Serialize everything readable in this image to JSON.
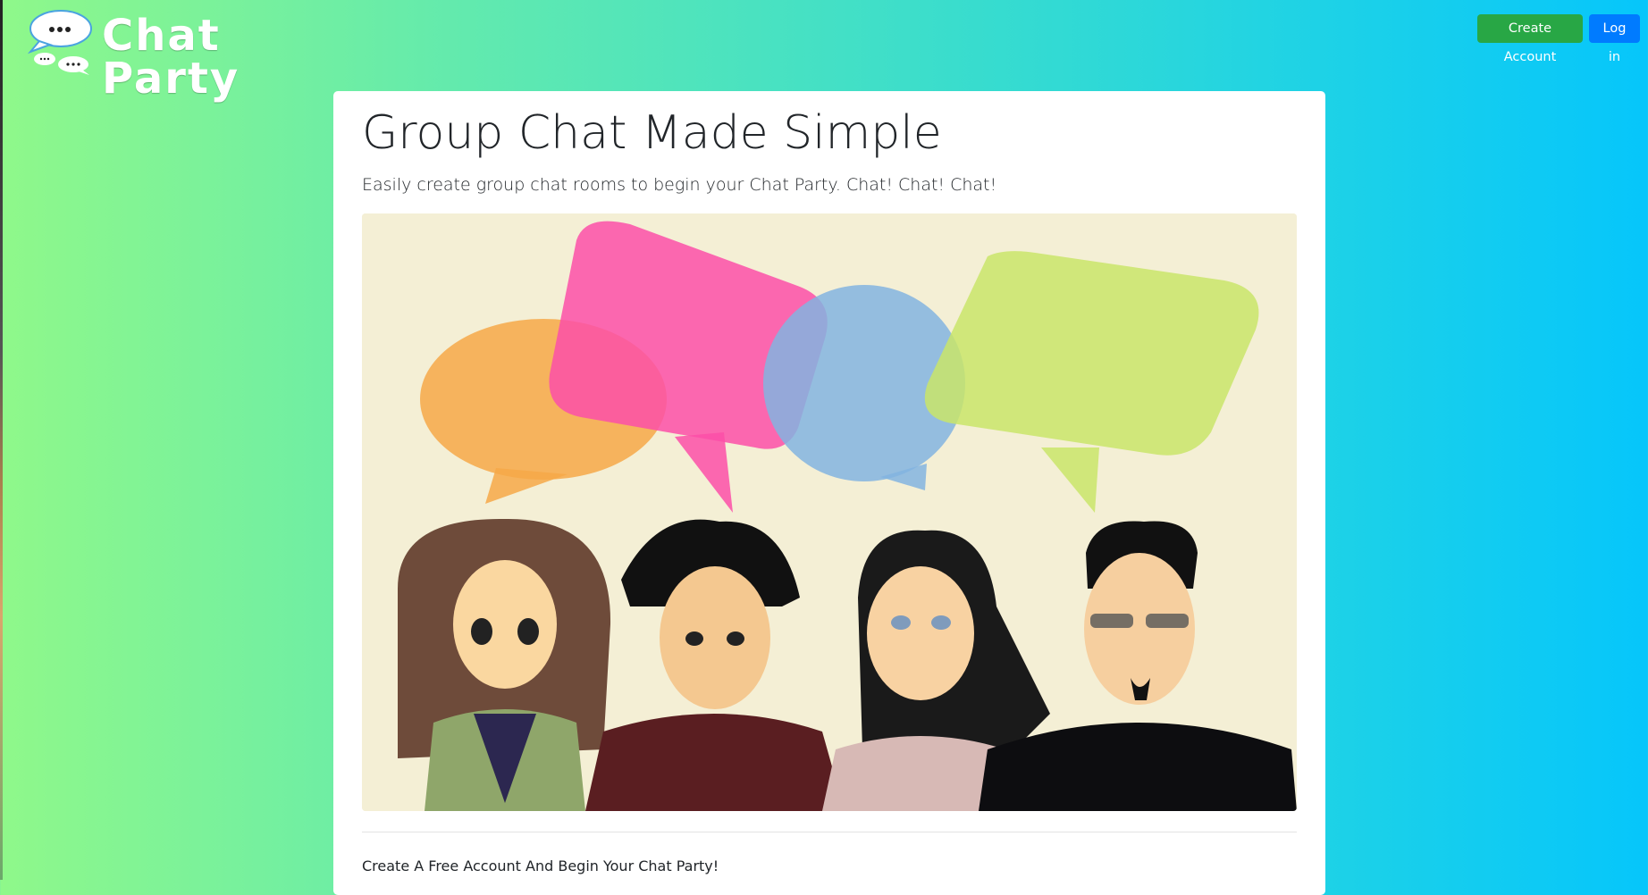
{
  "nav": {
    "brand": "Chat Party",
    "create_account_label": "Create Account",
    "login_label": "Log in"
  },
  "hero": {
    "title": "Group Chat Made Simple",
    "lead": "Easily create group chat rooms to begin your Chat Party. Chat! Chat! Chat!",
    "image_icon": "chat-people-illustration"
  },
  "cta": {
    "text": "Create A Free Account And Begin Your Chat Party!"
  },
  "colors": {
    "gradient_start": "#8ff88a",
    "gradient_end": "#06c6fb",
    "create_button": "#28a745",
    "login_button": "#007bff",
    "card_background": "#ffffff",
    "image_background": "#f4efd5"
  }
}
